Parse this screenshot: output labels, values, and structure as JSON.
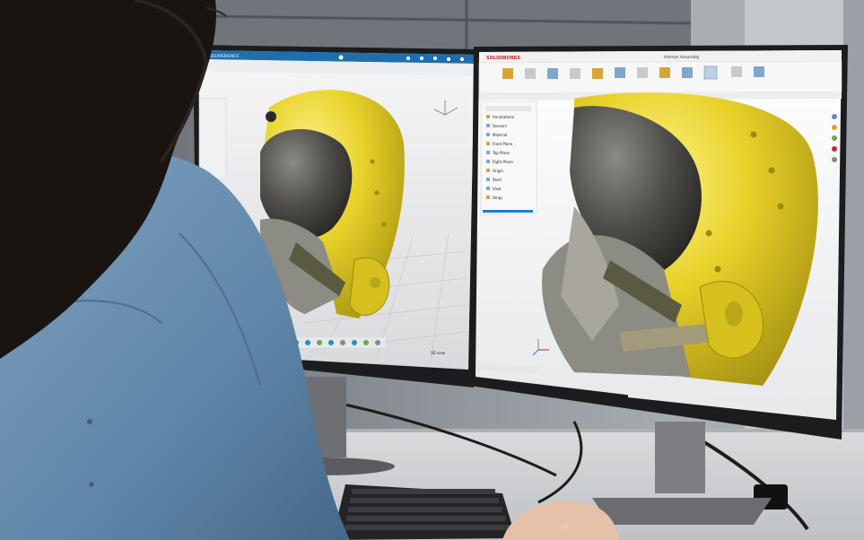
{
  "left_monitor": {
    "window_title": "3DEXPERIENCE",
    "viewer_label": "3D view"
  },
  "right_monitor": {
    "brand": "SOLIDWORKS",
    "file_title": "Helmet Assembly",
    "tree_items": [
      "Annotations",
      "Sensors",
      "Material",
      "Front Plane",
      "Top Plane",
      "Right Plane",
      "Origin",
      "Shell",
      "Visor",
      "Strap"
    ]
  },
  "colors": {
    "helmet_yellow": "#e3cf24",
    "visor_gray": "#4a4846",
    "mask_gray": "#8c8b84",
    "shirt_blue": "#5f86a8",
    "hair": "#1a1411",
    "accent_blue": "#1d7fc7"
  }
}
